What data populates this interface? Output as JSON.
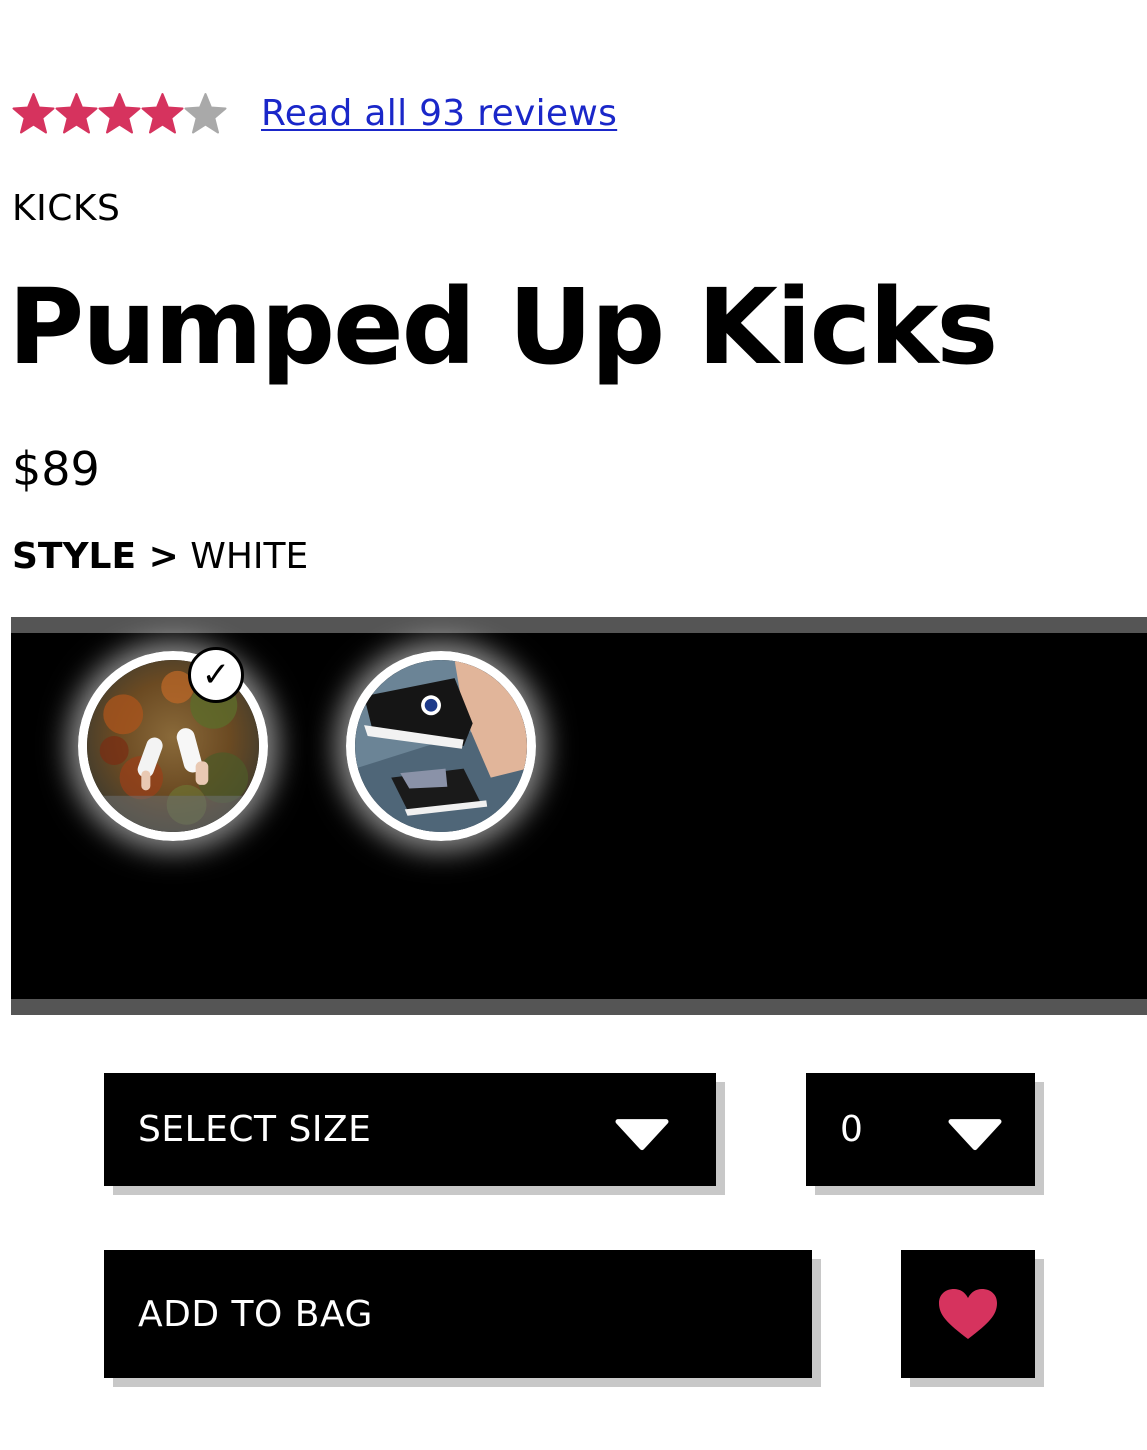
{
  "rating": {
    "value": 4,
    "max": 5,
    "filled_color": "#d6335e",
    "empty_color": "#a9a9a9",
    "reviews_link_text": "Read all 93 reviews"
  },
  "product": {
    "category": "KICKS",
    "title": "Pumped Up Kicks",
    "price": "$89",
    "style_label": "STYLE >",
    "style_value": "WHITE"
  },
  "swatches": [
    {
      "name": "white",
      "selected": true,
      "check_glyph": "✓"
    },
    {
      "name": "black",
      "selected": false
    }
  ],
  "size_select": {
    "label": "SELECT SIZE",
    "icon": "chevron-down-icon"
  },
  "quantity_select": {
    "value": "0",
    "icon": "chevron-down-icon"
  },
  "actions": {
    "add_to_bag_label": "ADD TO BAG",
    "wishlist_icon": "heart-icon",
    "heart_color": "#d6335e"
  }
}
